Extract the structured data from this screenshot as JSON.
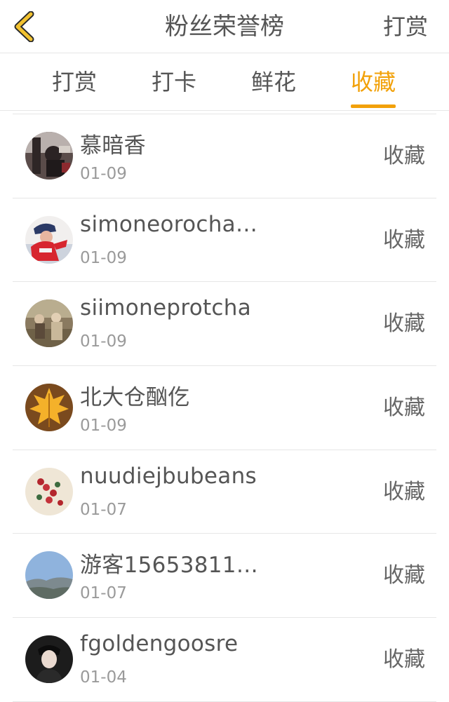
{
  "header": {
    "title": "粉丝荣誉榜",
    "right_action": "打赏",
    "back_icon": "chevron-left-icon",
    "accent_color": "#f2a109"
  },
  "tabs": [
    {
      "label": "打赏",
      "active": false
    },
    {
      "label": "打卡",
      "active": false
    },
    {
      "label": "鲜花",
      "active": false
    },
    {
      "label": "收藏",
      "active": true
    }
  ],
  "list": {
    "items": [
      {
        "name": "慕暗香",
        "date": "01-09",
        "action": "收藏"
      },
      {
        "name": "simoneorocha…",
        "date": "01-09",
        "action": "收藏"
      },
      {
        "name": "siimoneprotcha",
        "date": "01-09",
        "action": "收藏"
      },
      {
        "name": "北大仓酗仡",
        "date": "01-09",
        "action": "收藏"
      },
      {
        "name": "nuudiejbubeans",
        "date": "01-07",
        "action": "收藏"
      },
      {
        "name": "游客15653811…",
        "date": "01-07",
        "action": "收藏"
      },
      {
        "name": "fgoldengoosre",
        "date": "01-04",
        "action": "收藏"
      }
    ]
  }
}
